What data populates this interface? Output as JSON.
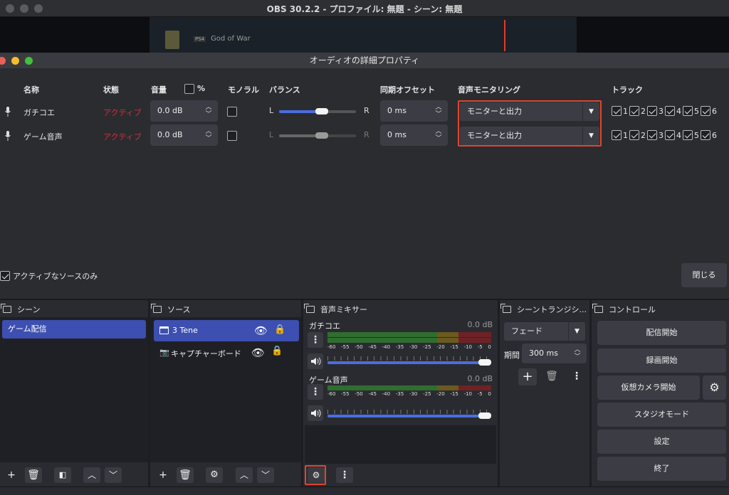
{
  "window": {
    "title": "OBS 30.2.2 - プロファイル: 無題 - シーン: 無題"
  },
  "preview": {
    "game_tag": "PS4",
    "game_title": "God of War"
  },
  "dialog": {
    "title": "オーディオの詳細プロパティ",
    "headers": {
      "name": "名称",
      "status": "状態",
      "volume": "音量",
      "percent": "%",
      "mono": "モノラル",
      "balance": "バランス",
      "sync_offset": "同期オフセット",
      "monitoring": "音声モニタリング",
      "tracks": "トラック"
    },
    "rows": [
      {
        "name": "ガチコエ",
        "status": "アクティブ",
        "volume": "0.0 dB",
        "balance_left": "L",
        "balance_right": "R",
        "balance": 0.5,
        "offset": "0 ms",
        "monitoring": "モニターと出力",
        "track_labels": [
          "1",
          "2",
          "3",
          "4",
          "5",
          "6"
        ]
      },
      {
        "name": "ゲーム音声",
        "status": "アクティブ",
        "volume": "0.0 dB",
        "balance_left": "L",
        "balance_right": "R",
        "balance": 0.5,
        "offset": "0 ms",
        "monitoring": "モニターと出力",
        "track_labels": [
          "1",
          "2",
          "3",
          "4",
          "5",
          "6"
        ]
      }
    ],
    "active_only_label": "アクティブなソースのみ",
    "close_label": "閉じる"
  },
  "docks": {
    "scenes": {
      "title": "シーン",
      "items": [
        "ゲーム配信"
      ]
    },
    "sources": {
      "title": "ソース",
      "items": [
        {
          "label": "3 Tene",
          "icon": "window-icon"
        },
        {
          "label": "キャプチャーボード",
          "icon": "camera-icon"
        }
      ]
    },
    "mixer": {
      "title": "音声ミキサー",
      "channels": [
        {
          "name": "ガチコエ",
          "db": "0.0 dB"
        },
        {
          "name": "ゲーム音声",
          "db": "0.0 dB"
        }
      ],
      "scale": [
        "-60",
        "-55",
        "-50",
        "-45",
        "-40",
        "-35",
        "-30",
        "-25",
        "-20",
        "-15",
        "-10",
        "-5",
        "0"
      ]
    },
    "transitions": {
      "title": "シーントランジシ...",
      "transition": "フェード",
      "duration_label": "期間",
      "duration": "300 ms"
    },
    "controls": {
      "title": "コントロール",
      "buttons": [
        "配信開始",
        "録画開始",
        "仮想カメラ開始",
        "スタジオモード",
        "設定",
        "終了"
      ]
    }
  },
  "colors": {
    "accent": "#3d4fb0",
    "active": "#d12f3b",
    "highlight": "#e0452e"
  }
}
